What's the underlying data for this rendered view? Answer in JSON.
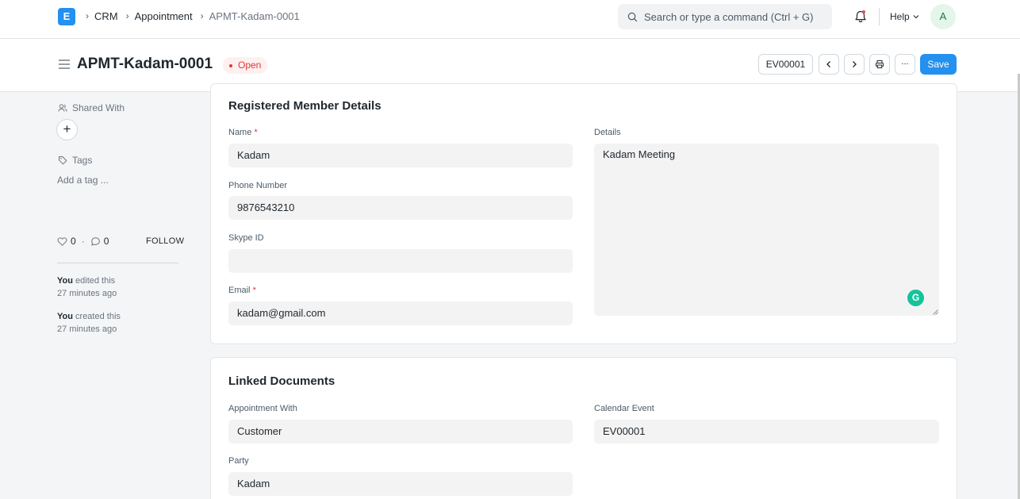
{
  "navbar": {
    "logo_letter": "E",
    "breadcrumbs": [
      "CRM",
      "Appointment",
      "APMT-Kadam-0001"
    ],
    "search_placeholder": "Search or type a command (Ctrl + G)",
    "help_label": "Help",
    "avatar_initial": "A"
  },
  "header": {
    "title": "APMT-Kadam-0001",
    "status": "Open",
    "status_color": "#e03636",
    "linked_doc_button": "EV00001",
    "more_label": "...",
    "save_label": "Save",
    "accent_color": "#2490ef"
  },
  "sidebar": {
    "shared_with_label": "Shared With",
    "add_share_label": "+",
    "tags_label": "Tags",
    "add_tag_label": "Add a tag ...",
    "likes_count": "0",
    "stat_separator": "·",
    "comments_count": "0",
    "follow_label": "FOLLOW",
    "activity": [
      {
        "actor": "You",
        "action": "edited this",
        "time": "27 minutes ago"
      },
      {
        "actor": "You",
        "action": "created this",
        "time": "27 minutes ago"
      }
    ]
  },
  "member_section": {
    "title": "Registered Member Details",
    "required_mark": "*",
    "name_label": "Name",
    "name_value": "Kadam",
    "phone_label": "Phone Number",
    "phone_value": "9876543210",
    "skype_label": "Skype ID",
    "skype_value": "",
    "email_label": "Email",
    "email_value": "kadam@gmail.com",
    "details_label": "Details",
    "details_value": "Kadam Meeting",
    "grammarly_letter": "G"
  },
  "linked_section": {
    "title": "Linked Documents",
    "appointment_with_label": "Appointment With",
    "appointment_with_value": "Customer",
    "calendar_event_label": "Calendar Event",
    "calendar_event_value": "EV00001",
    "party_label": "Party",
    "party_value": "Kadam"
  }
}
